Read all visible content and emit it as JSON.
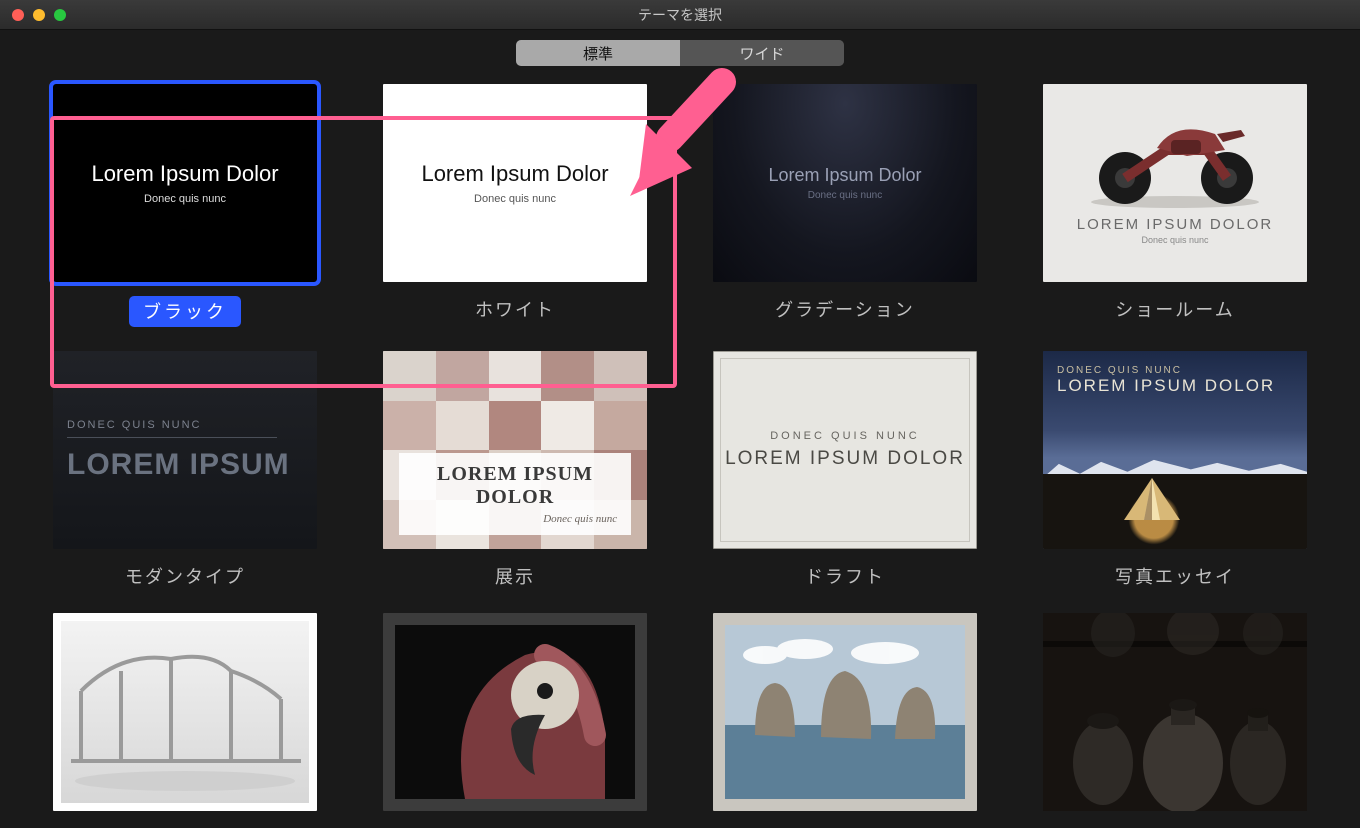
{
  "window": {
    "title": "テーマを選択"
  },
  "segmented": {
    "standard": "標準",
    "wide": "ワイド",
    "active": "standard"
  },
  "placeholder": {
    "heading": "Lorem Ipsum Dolor",
    "sub": "Donec quis nunc",
    "heading_upper": "LOREM IPSUM DOLOR",
    "sub_upper": "DONEC QUIS NUNC",
    "heading_short": "LOREM IPSUM"
  },
  "themes": [
    {
      "id": "black",
      "label": "ブラック",
      "selected": true
    },
    {
      "id": "white",
      "label": "ホワイト",
      "selected": false
    },
    {
      "id": "gradient",
      "label": "グラデーション",
      "selected": false
    },
    {
      "id": "showroom",
      "label": "ショールーム",
      "selected": false
    },
    {
      "id": "modern",
      "label": "モダンタイプ",
      "selected": false
    },
    {
      "id": "exhibit",
      "label": "展示",
      "selected": false
    },
    {
      "id": "draft",
      "label": "ドラフト",
      "selected": false
    },
    {
      "id": "photoessay",
      "label": "写真エッセイ",
      "selected": false
    }
  ],
  "annotation": {
    "highlight_targets": [
      "black",
      "white"
    ],
    "arrow_points_to": "white"
  },
  "colors": {
    "selection": "#2a57ff",
    "highlight": "#ff5f91"
  }
}
